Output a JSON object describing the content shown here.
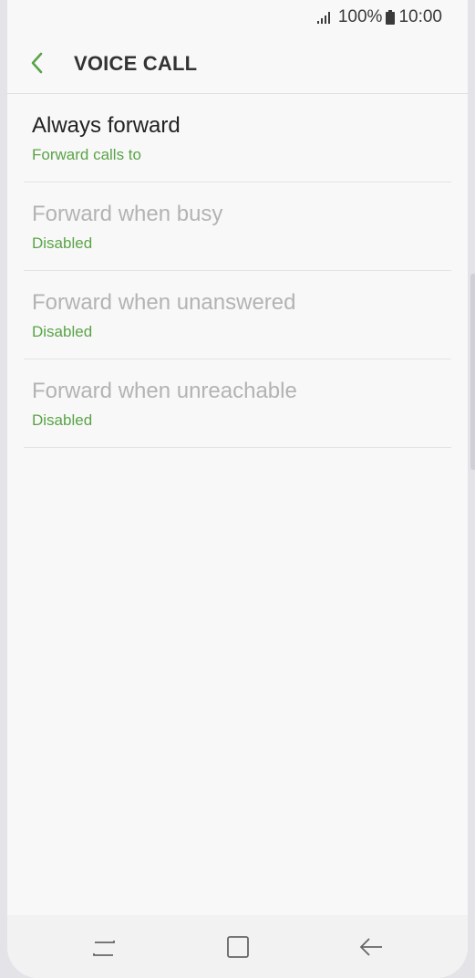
{
  "status_bar": {
    "battery_percent": "100%",
    "time": "10:00",
    "icons": [
      "signal-icon",
      "battery-icon"
    ]
  },
  "app_bar": {
    "title": "VOICE CALL",
    "back_icon": "chevron-left-icon"
  },
  "items": [
    {
      "label": "Always forward",
      "sub": "Forward calls to",
      "enabled": true
    },
    {
      "label": "Forward when busy",
      "sub": "Disabled",
      "enabled": false
    },
    {
      "label": "Forward when unanswered",
      "sub": "Disabled",
      "enabled": false
    },
    {
      "label": "Forward when unreachable",
      "sub": "Disabled",
      "enabled": false
    }
  ],
  "nav_bar": {
    "buttons": [
      "recents-icon",
      "home-icon",
      "back-icon"
    ]
  },
  "colors": {
    "accent": "#5aa347",
    "background": "#f8f8f8",
    "disabled_text": "#b3b3b3"
  }
}
